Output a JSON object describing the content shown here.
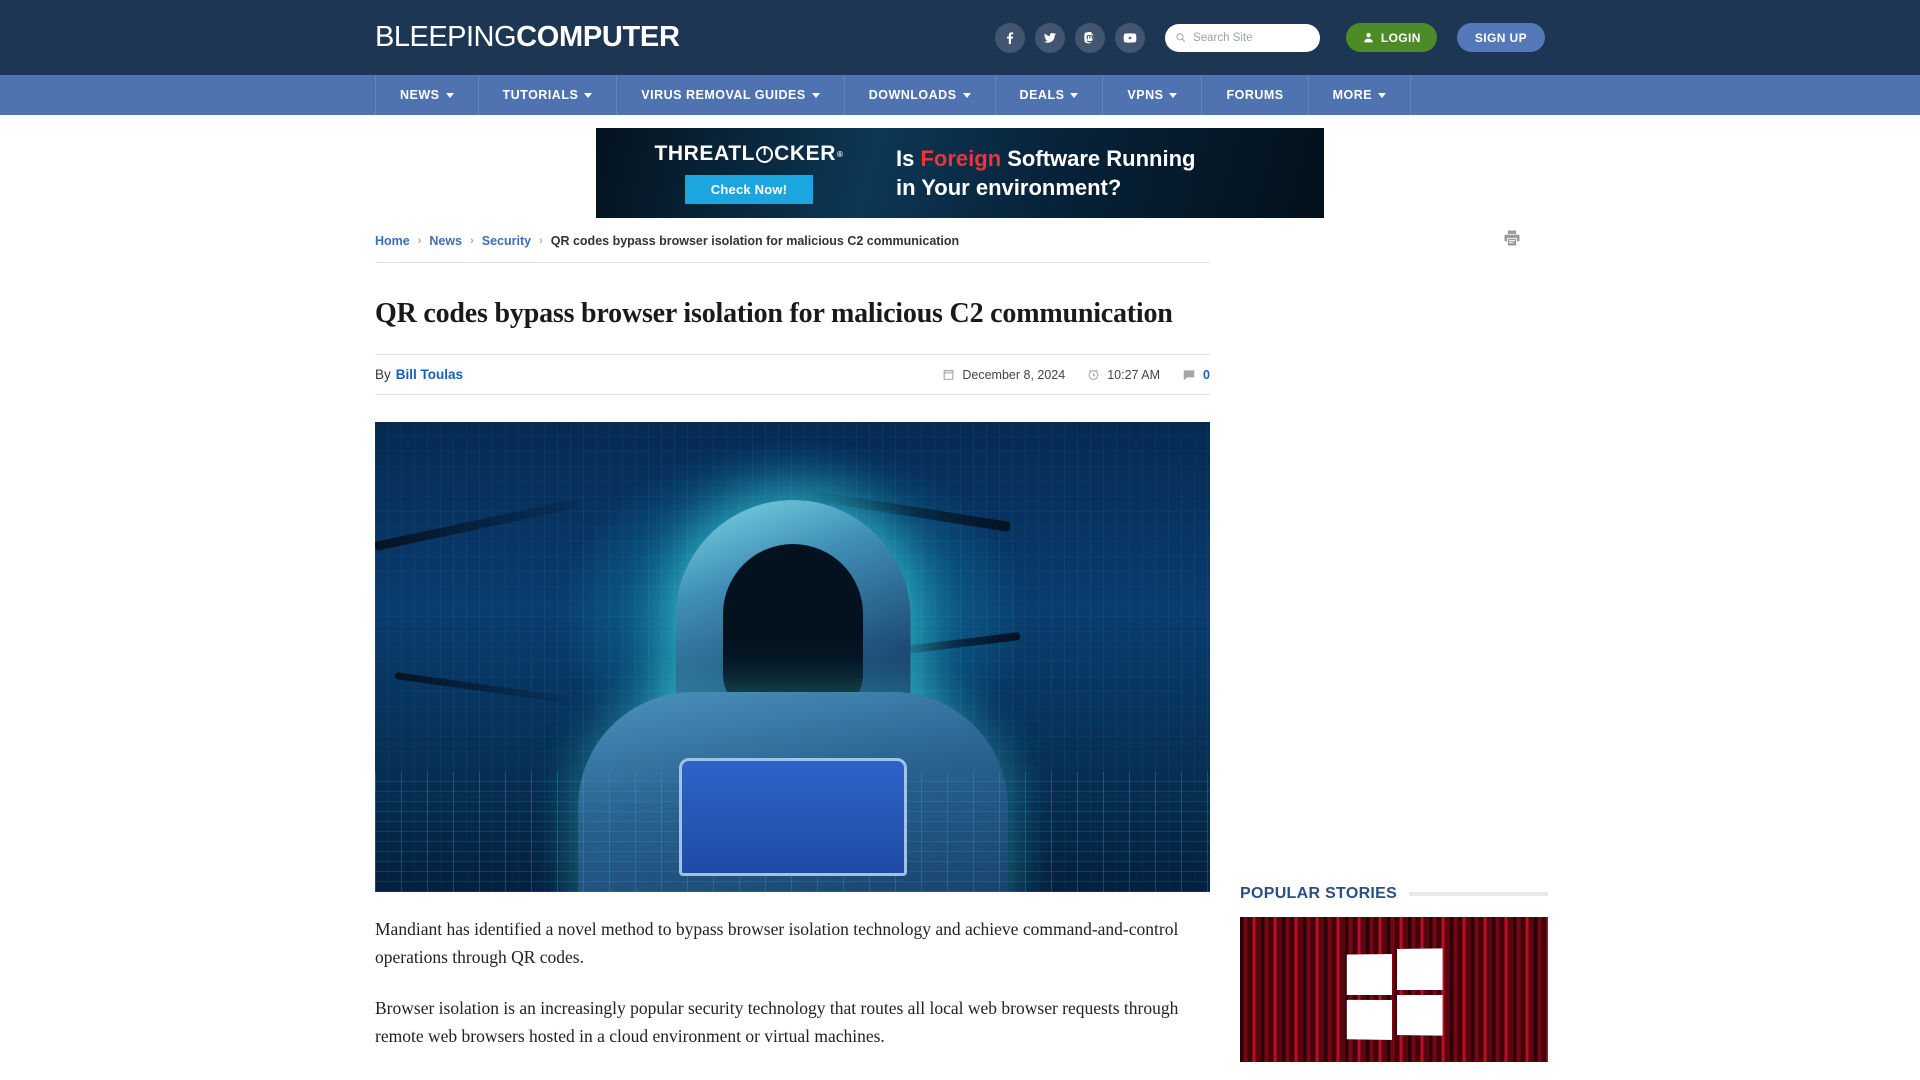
{
  "site": {
    "logo_thin": "BLEEPING",
    "logo_bold": "COMPUTER"
  },
  "header": {
    "social": [
      {
        "name": "facebook-icon",
        "label": "Facebook"
      },
      {
        "name": "twitter-icon",
        "label": "Twitter"
      },
      {
        "name": "mastodon-icon",
        "label": "Mastodon"
      },
      {
        "name": "youtube-icon",
        "label": "YouTube"
      }
    ],
    "search": {
      "placeholder": "Search Site",
      "value": "",
      "icon": "search-icon"
    },
    "login_label": "LOGIN",
    "signup_label": "SIGN UP",
    "login_color": "#4c8b26",
    "signup_color": "#5478b8"
  },
  "nav": {
    "items": [
      {
        "label": "NEWS",
        "has_dropdown": true
      },
      {
        "label": "TUTORIALS",
        "has_dropdown": true
      },
      {
        "label": "VIRUS REMOVAL GUIDES",
        "has_dropdown": true
      },
      {
        "label": "DOWNLOADS",
        "has_dropdown": true
      },
      {
        "label": "DEALS",
        "has_dropdown": true
      },
      {
        "label": "VPNS",
        "has_dropdown": true
      },
      {
        "label": "FORUMS",
        "has_dropdown": false
      },
      {
        "label": "MORE",
        "has_dropdown": true
      }
    ],
    "background": "#4f72b0"
  },
  "ad": {
    "brand": "THREATL",
    "brand_tail": "CKER",
    "registered": "®",
    "cta_label": "Check Now!",
    "headline_pre": "Is ",
    "headline_highlight": "Foreign",
    "headline_post": " Software Running",
    "headline_line2": "in Your environment?",
    "highlight_color": "#ef3434",
    "cta_color": "#1ba6e0"
  },
  "breadcrumb": {
    "items": [
      {
        "label": "Home",
        "link": true
      },
      {
        "label": "News",
        "link": true
      },
      {
        "label": "Security",
        "link": true
      },
      {
        "label": "QR codes bypass browser isolation for malicious C2 communication",
        "link": false
      }
    ],
    "separator": "›",
    "print_icon": "print-icon"
  },
  "article": {
    "title": "QR codes bypass browser isolation for malicious C2 communication",
    "by_label": "By",
    "author": "Bill Toulas",
    "date": "December 8, 2024",
    "time": "10:27 AM",
    "comment_count": "0",
    "hero_alt": "Hooded hacker using a laptop in a neon blue digital city",
    "paragraphs": [
      "Mandiant has identified a novel method to bypass browser isolation technology and achieve command-and-control operations through QR codes.",
      "Browser isolation is an increasingly popular security technology that routes all local web browser requests through remote web browsers hosted in a cloud environment or virtual machines."
    ]
  },
  "sidebar": {
    "popular_title": "POPULAR STORIES",
    "popular_thumb_alt": "Red glitched Windows logo"
  }
}
